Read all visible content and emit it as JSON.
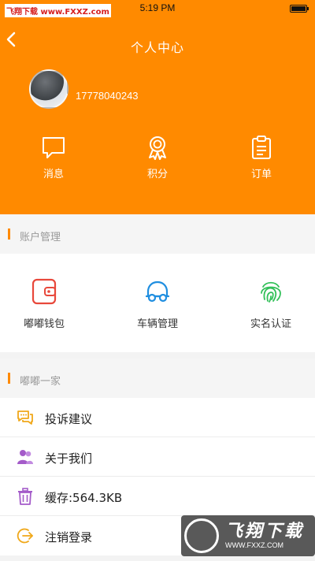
{
  "status_bar": {
    "carrier": "飞翔下载 www.FXXZ.com",
    "time": "5:19 PM"
  },
  "nav": {
    "title": "个人中心"
  },
  "profile": {
    "phone": "17778040243"
  },
  "quick_actions": [
    {
      "label": "消息",
      "icon": "message-icon"
    },
    {
      "label": "积分",
      "icon": "medal-icon"
    },
    {
      "label": "订单",
      "icon": "clipboard-icon"
    }
  ],
  "account_section": {
    "title": "账户管理",
    "items": [
      {
        "label": "嘟嘟钱包",
        "icon": "wallet-icon",
        "color": "#e8483b"
      },
      {
        "label": "车辆管理",
        "icon": "car-icon",
        "color": "#1f8ee0"
      },
      {
        "label": "实名认证",
        "icon": "fingerprint-icon",
        "color": "#32c059"
      }
    ]
  },
  "family_section": {
    "title": "嘟嘟一家",
    "items": [
      {
        "label": "投诉建议",
        "icon": "chat-bubbles-icon",
        "color": "#f0a81a"
      },
      {
        "label": "关于我们",
        "icon": "people-icon",
        "color": "#a45bc9"
      },
      {
        "label": "缓存:564.3KB",
        "icon": "trash-icon",
        "color": "#a45bc9"
      },
      {
        "label": "注销登录",
        "icon": "logout-icon",
        "color": "#f0a81a"
      }
    ]
  },
  "watermark": {
    "title": "飞翔下载",
    "url": "WWW.FXXZ.COM"
  },
  "colors": {
    "accent": "#ff8a00",
    "background": "#f3f3f3"
  }
}
